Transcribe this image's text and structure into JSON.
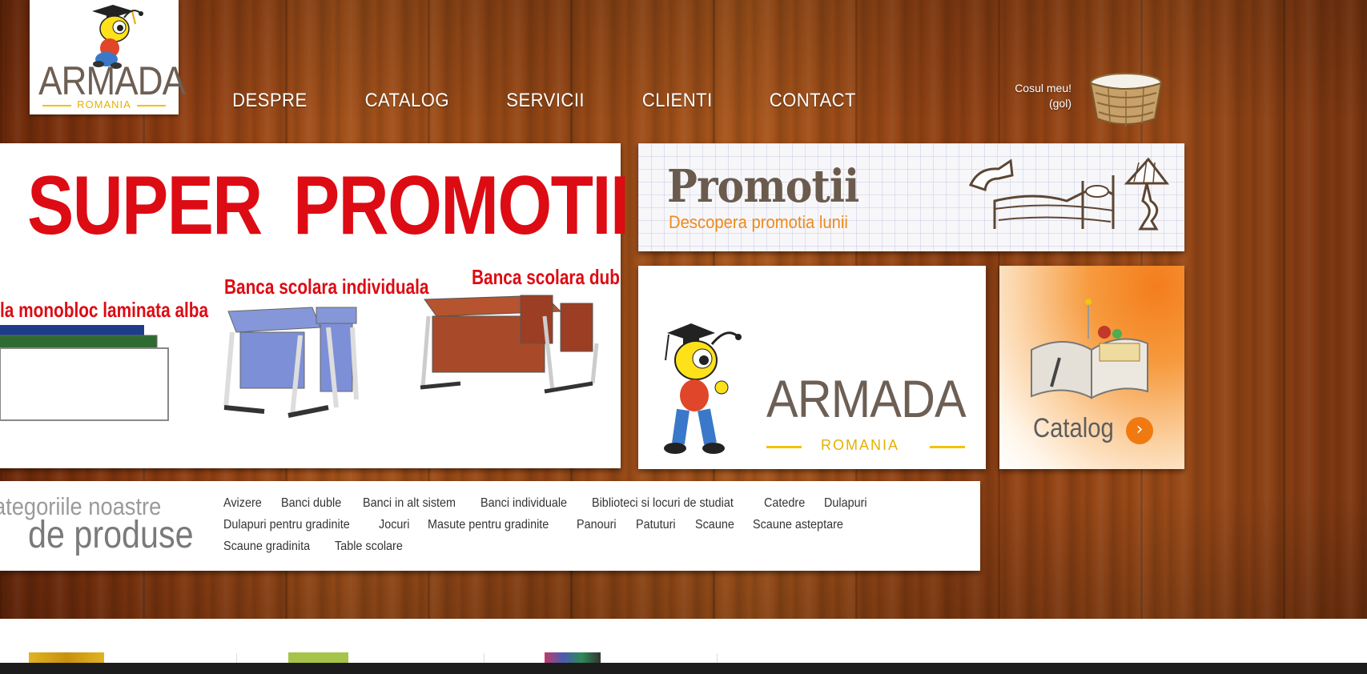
{
  "header": {
    "logo": {
      "word": "ARMADA",
      "sub": "ROMANIA"
    },
    "nav": [
      "DESPRE",
      "CATALOG",
      "SERVICII",
      "CLIENTI",
      "CONTACT"
    ],
    "cart": {
      "line1": "Cosul meu!",
      "line2": "(gol)"
    }
  },
  "promo_main": {
    "title": "SUPER PROMOTII",
    "products": [
      "la monobloc laminata alba",
      "Banca scolara individuala",
      "Banca scolara dubla"
    ]
  },
  "promotii_banner": {
    "title": "Promotii",
    "subtitle": "Descopera promotia lunii"
  },
  "brand_banner": {
    "word": "ARMADA",
    "sub": "ROMANIA"
  },
  "catalog_banner": {
    "label": "Catalog",
    "arrow": "›"
  },
  "categories": {
    "heading_line1": "ategoriile noastre",
    "heading_line2": "de produse",
    "items": [
      "Avizere",
      "Banci duble",
      "Banci in alt sistem",
      "Banci individuale",
      "Biblioteci si locuri de studiat",
      "Catedre",
      "Dulapuri",
      "Dulapuri pentru gradinite",
      "Jocuri",
      "Masute pentru gradinite",
      "Panouri",
      "Patuturi",
      "Scaune",
      "Scaune asteptare",
      "Scaune gradinita",
      "Table scolare"
    ]
  },
  "colors": {
    "accent_red": "#dd0b13",
    "accent_orange": "#f07a10",
    "brand_yellow": "#f2c200",
    "brand_gray": "#6d5f54"
  }
}
